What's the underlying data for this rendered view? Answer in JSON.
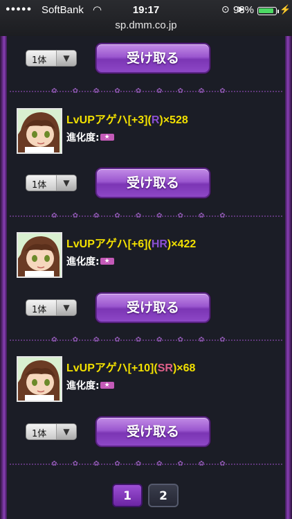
{
  "status_bar": {
    "signal": "●●●●●",
    "carrier": "SoftBank",
    "time": "19:17",
    "battery_percent": "93%",
    "battery_level": 0.93
  },
  "url": "sp.dmm.co.jp",
  "receive_label": "受け取る",
  "quantity_value": "1体",
  "items": [
    {
      "name_prefix": "LvUPアゲハ[+3](",
      "rarity": "R",
      "name_suffix": ")×528",
      "evolution_label": "進化度:"
    },
    {
      "name_prefix": "LvUPアゲハ[+6](",
      "rarity": "HR",
      "name_suffix": ")×422",
      "evolution_label": "進化度:"
    },
    {
      "name_prefix": "LvUPアゲハ[+10](",
      "rarity": "SR",
      "name_suffix": ")×68",
      "evolution_label": "進化度:"
    }
  ],
  "pagination": {
    "page1": "1",
    "page2": "2",
    "current": "1"
  },
  "colors": {
    "accent_purple": "#8a3fb7",
    "item_name": "#f2e000",
    "rarity_r": "#8a4fd1",
    "rarity_sr": "#e0608a"
  }
}
